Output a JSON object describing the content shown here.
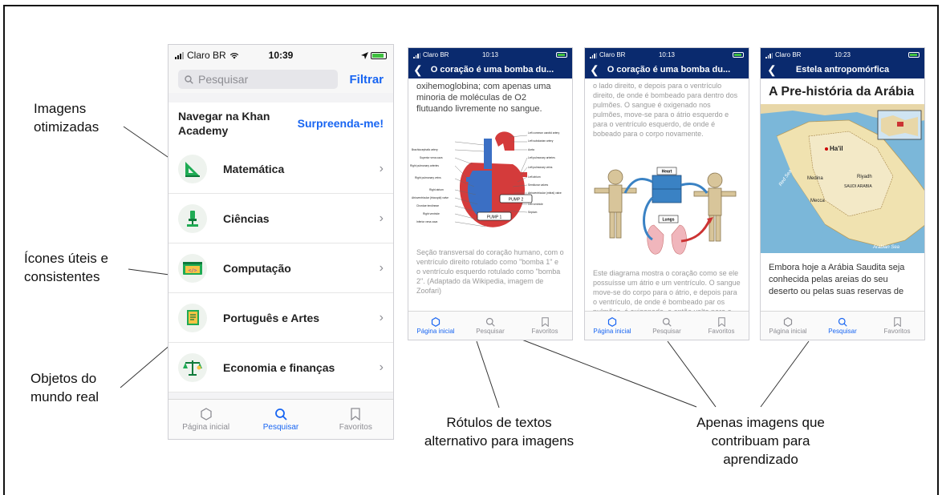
{
  "annotations": {
    "optimized_images": "Imagens otimizadas",
    "useful_icons": "Ícones úteis e consistentes",
    "real_world": "Objetos do mundo real",
    "alt_text": "Rótulos de textos alternativo para imagens",
    "only_images": "Apenas imagens que contribuam para aprendizado"
  },
  "big_phone": {
    "status": {
      "carrier": "Claro BR",
      "time": "10:39"
    },
    "search_placeholder": "Pesquisar",
    "filter": "Filtrar",
    "browse_title": "Navegar na Khan Academy",
    "surprise": "Surpreenda-me!",
    "subjects": [
      {
        "label": "Matemática",
        "icon": "triangle-ruler-icon"
      },
      {
        "label": "Ciências",
        "icon": "microscope-icon"
      },
      {
        "label": "Computação",
        "icon": "code-screen-icon"
      },
      {
        "label": "Português e Artes",
        "icon": "book-icon"
      },
      {
        "label": "Economia e finanças",
        "icon": "scales-icon"
      }
    ],
    "tabs": [
      {
        "label": "Página inicial",
        "icon": "home-hexagon-icon"
      },
      {
        "label": "Pesquisar",
        "icon": "search-icon"
      },
      {
        "label": "Favoritos",
        "icon": "bookmark-icon"
      }
    ]
  },
  "phone1": {
    "status": {
      "carrier": "Claro BR",
      "time": "10:13"
    },
    "title": "O coração é uma bomba du...",
    "body": "oxihemoglobina; com apenas uma minoria de moléculas de O2 flutuando livremente no sangue.",
    "heart_labels": {
      "left_common_carotid": "Left common carotid artery",
      "left_subclavian": "Left subclavian artery",
      "brachiocephalic": "Brachiocephalic artery",
      "superior_vena_cava": "Superior vena cava",
      "aorta": "Aorta",
      "right_pulmonary_arteries": "Right pulmonary arteries",
      "left_pulmonary_arteries": "Left pulmonary arteries",
      "right_pulmonary_veins": "Right pulmonary veins",
      "left_pulmonary_veins": "Left pulmonary veins",
      "left_atrium": "Left atrium",
      "right_atrium": "Right atrium",
      "semilunar_valves": "Semilunar valves",
      "av_tricuspid": "Atrioventricular (tricuspid) valve",
      "av_mitral": "Atrioventricular (mitral) valve",
      "left_ventricle": "Left ventricle",
      "chordae": "Chordae tendineae",
      "right_ventricle": "Right ventricle",
      "septum": "Septum",
      "inferior_vena_cava": "Inferior vena cava",
      "pump1": "PUMP 1",
      "pump2": "PUMP 2"
    },
    "caption": "Seção transversal do coração humano, com o ventrículo direito rotulado como \"bomba 1\" e o ventrículo esquerdo rotulado como \"bomba 2\". (Adaptado da Wikipedia, imagem de Zoofari)",
    "tabs": [
      "Página inicial",
      "Pesquisar",
      "Favoritos"
    ]
  },
  "phone2": {
    "status": {
      "carrier": "Claro BR",
      "time": "10:13"
    },
    "title": "O coração é uma bomba du...",
    "body": "o lado direito, e depois para o ventrículo direito, de onde é bombeado para dentro dos pulmões. O sangue é oxigenado nos pulmões, move-se para o átrio esquerdo e para o ventrículo esquerdo, de onde é bobeado para o corpo novamente.",
    "diagram": {
      "heart": "Heart",
      "lungs": "Lungs"
    },
    "caption": "Este diagrama mostra o coração como se ele possuísse um átrio e um ventrículo. O sangue move-se do corpo para o átrio, e depois para o ventrículo, de onde é bombeado par os pulmões, é oxigenado, e então volta para o corpo novamente.",
    "tabs": [
      "Página inicial",
      "Pesquisar",
      "Favoritos"
    ]
  },
  "phone3": {
    "status": {
      "carrier": "Claro BR",
      "time": "10:23"
    },
    "title": "Estela antropomórfica",
    "heading": "A Pre-história da Arábia",
    "map_labels": {
      "hail": "Ha'il",
      "medina": "Medina",
      "riyadh": "Riyadh",
      "saudi_arabia": "SAUDI ARABIA",
      "mecca": "Mecca",
      "arabian_sea": "Arabian Sea",
      "red_sea": "Red Sea"
    },
    "body": "Embora hoje a Arábia Saudita seja conhecida pelas areias do seu deserto ou pelas suas reservas de",
    "tabs": [
      "Página inicial",
      "Pesquisar",
      "Favoritos"
    ]
  },
  "colors": {
    "accent": "#1865f2",
    "nav": "#0a2a6e",
    "chart_blue": "#3a82c4"
  }
}
